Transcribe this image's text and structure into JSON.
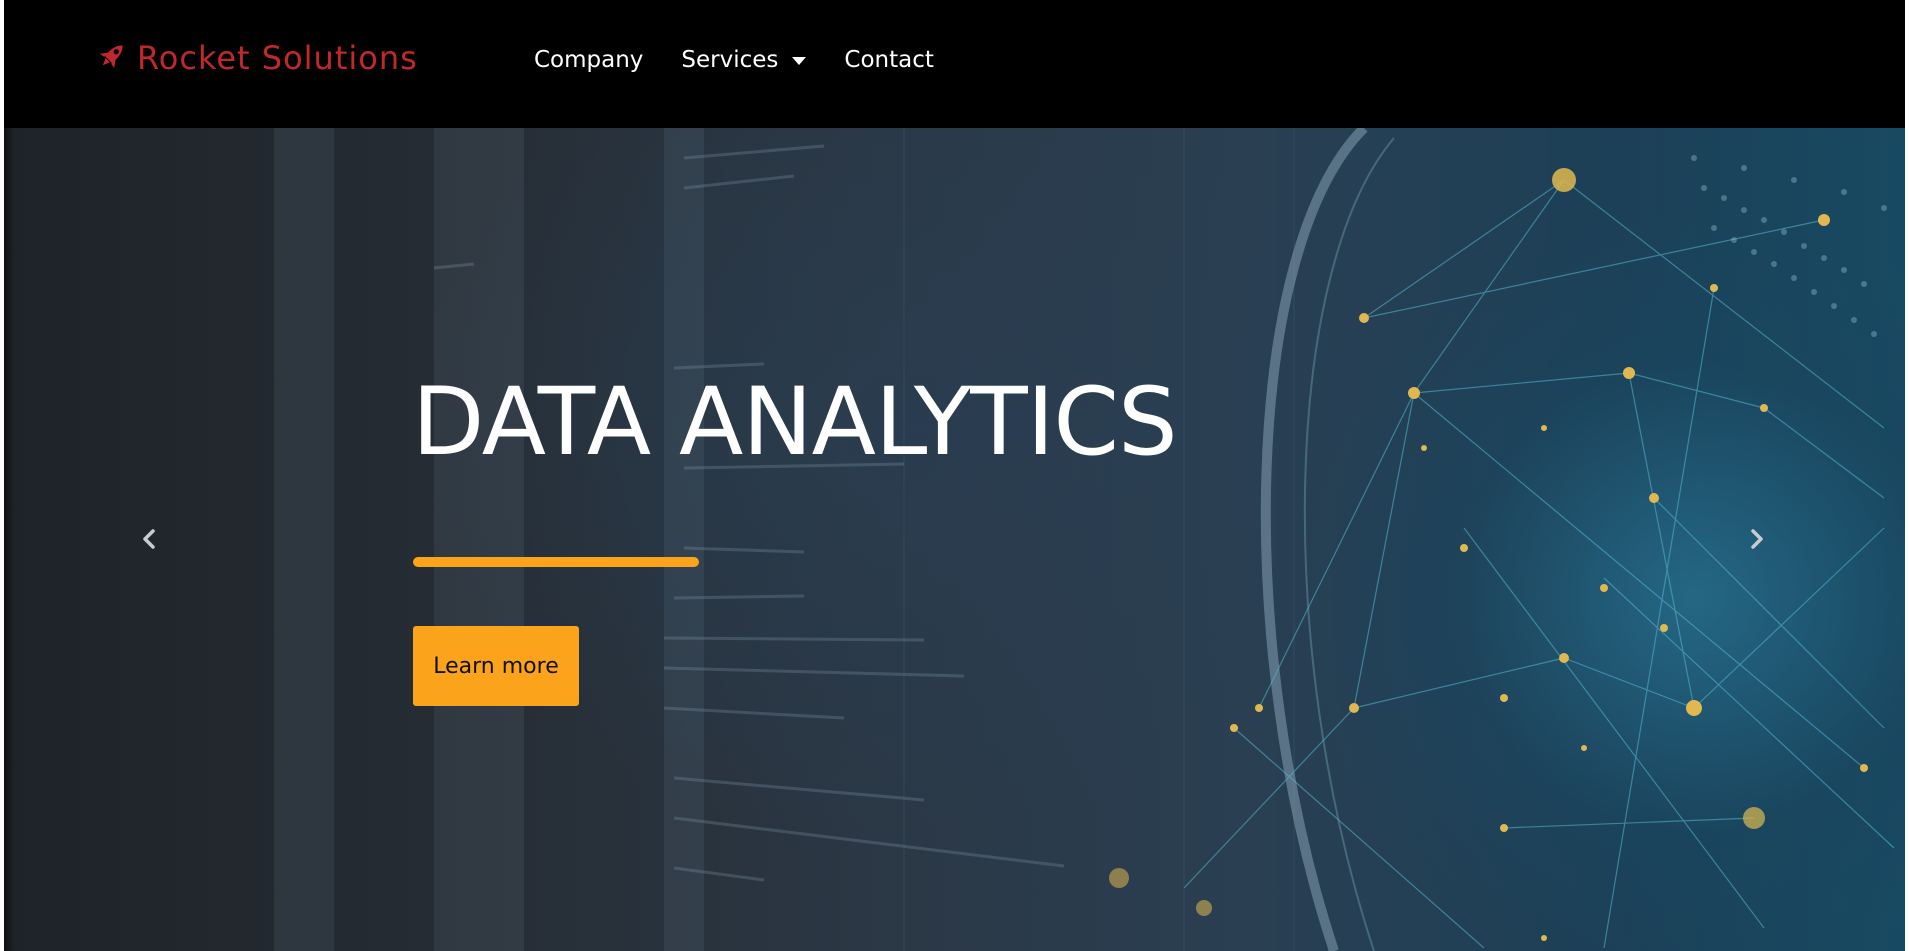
{
  "brand": {
    "name": "Rocket Solutions",
    "color": "#c0282b",
    "icon": "rocket-icon"
  },
  "nav": {
    "items": [
      {
        "label": "Company"
      },
      {
        "label": "Services",
        "has_dropdown": true
      },
      {
        "label": "Contact"
      }
    ]
  },
  "hero": {
    "title": "DATA ANALYTICS",
    "button_label": "Learn more",
    "accent_color": "#fba31a",
    "prev_icon": "chevron-left-icon",
    "next_icon": "chevron-right-icon"
  }
}
